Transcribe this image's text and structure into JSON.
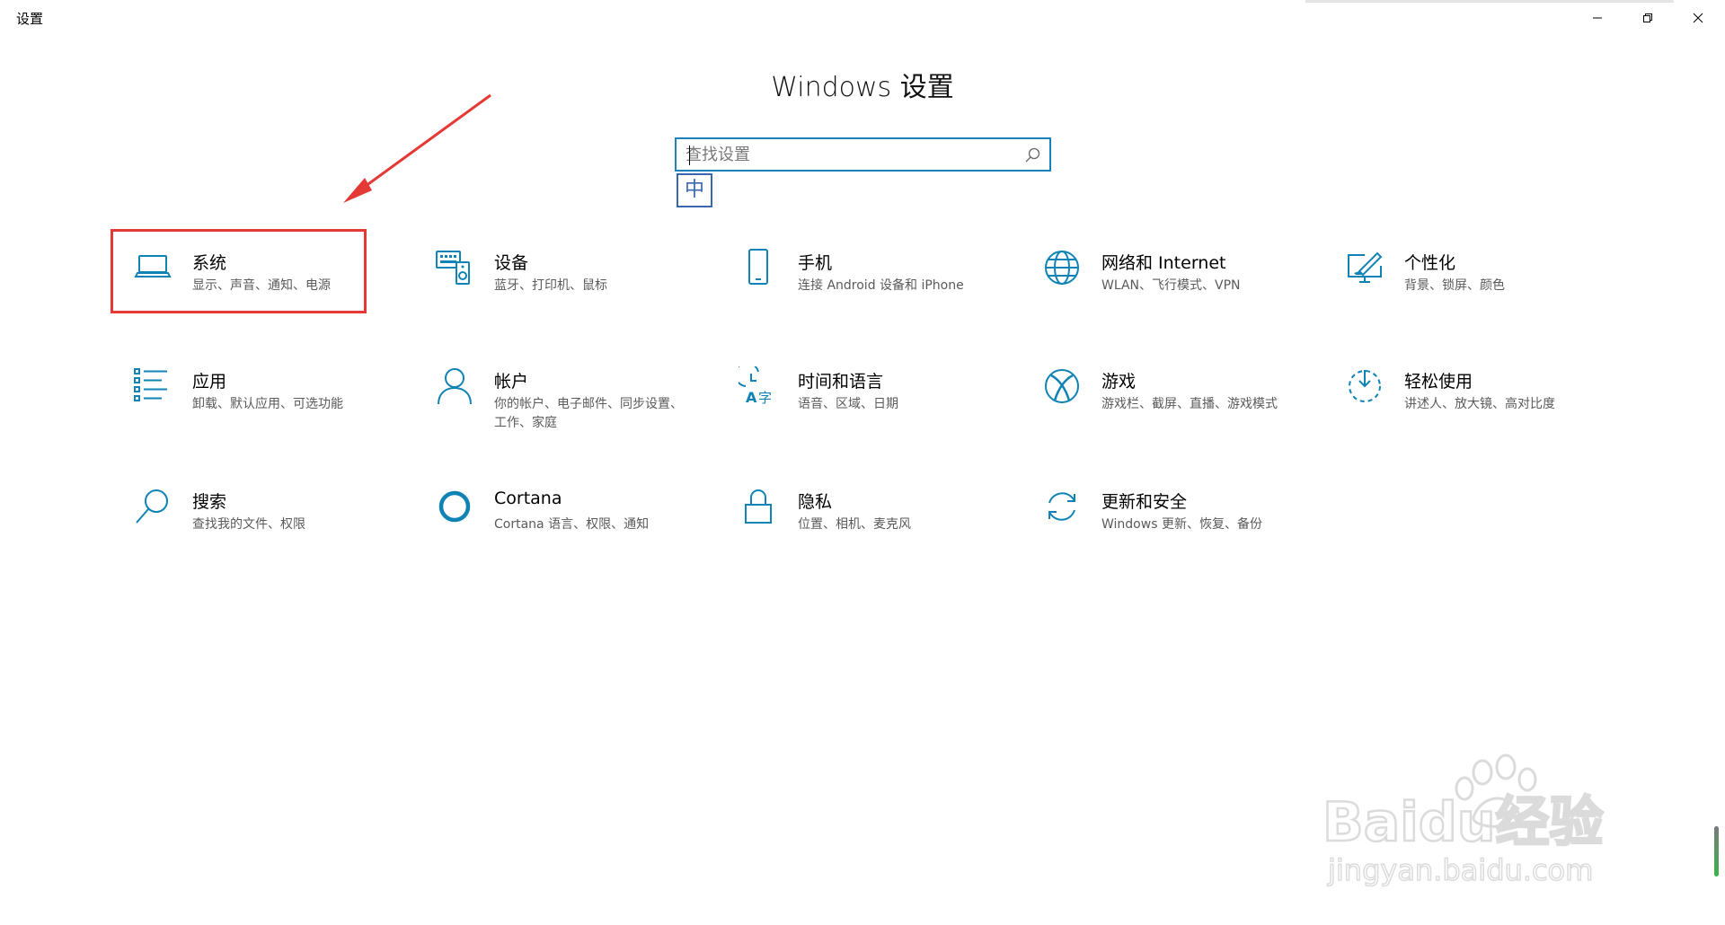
{
  "window": {
    "title": "设置",
    "minimize_icon": "minimize-icon",
    "maximize_icon": "restore-icon",
    "close_icon": "close-icon"
  },
  "page": {
    "title": "Windows 设置"
  },
  "search": {
    "placeholder": "查找设置",
    "value": "",
    "icon": "search-icon",
    "ime_indicator": "中"
  },
  "accent_color": "#0f83b5",
  "highlight_color": "#e53935",
  "tiles": [
    {
      "icon": "laptop-icon",
      "title": "系统",
      "desc": "显示、声音、通知、电源"
    },
    {
      "icon": "keyboard-speaker-icon",
      "title": "设备",
      "desc": "蓝牙、打印机、鼠标"
    },
    {
      "icon": "phone-icon",
      "title": "手机",
      "desc": "连接 Android 设备和 iPhone"
    },
    {
      "icon": "globe-icon",
      "title": "网络和 Internet",
      "desc": "WLAN、飞行模式、VPN"
    },
    {
      "icon": "paint-monitor-icon",
      "title": "个性化",
      "desc": "背景、锁屏、颜色"
    },
    {
      "icon": "app-list-icon",
      "title": "应用",
      "desc": "卸载、默认应用、可选功能"
    },
    {
      "icon": "person-icon",
      "title": "帐户",
      "desc": "你的帐户、电子邮件、同步设置、工作、家庭"
    },
    {
      "icon": "time-language-icon",
      "title": "时间和语言",
      "desc": "语音、区域、日期"
    },
    {
      "icon": "xbox-icon",
      "title": "游戏",
      "desc": "游戏栏、截屏、直播、游戏模式"
    },
    {
      "icon": "ease-of-access-icon",
      "title": "轻松使用",
      "desc": "讲述人、放大镜、高对比度"
    },
    {
      "icon": "magnifier-icon",
      "title": "搜索",
      "desc": "查找我的文件、权限"
    },
    {
      "icon": "cortana-icon",
      "title": "Cortana",
      "desc": "Cortana 语言、权限、通知"
    },
    {
      "icon": "lock-icon",
      "title": "隐私",
      "desc": "位置、相机、麦克风"
    },
    {
      "icon": "sync-icon",
      "title": "更新和安全",
      "desc": "Windows 更新、恢复、备份"
    }
  ],
  "watermark": {
    "brand": "Baidu经验",
    "url": "jingyan.baidu.com"
  }
}
